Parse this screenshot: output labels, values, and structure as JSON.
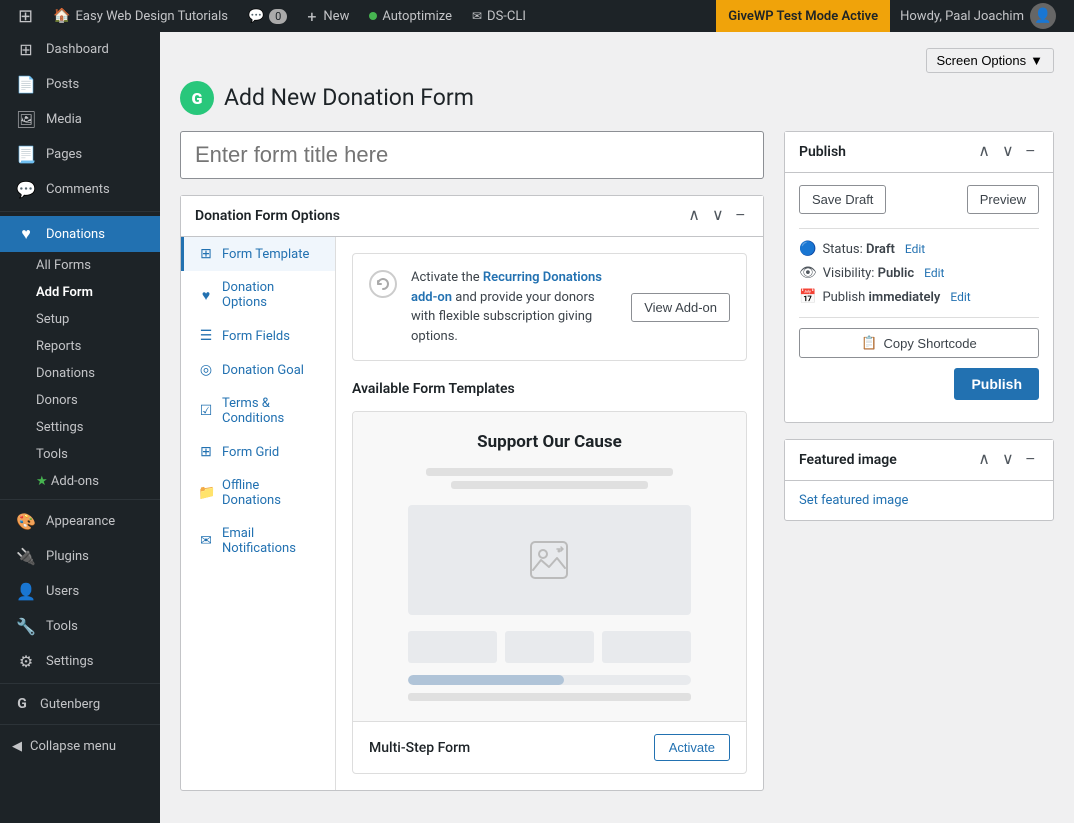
{
  "adminbar": {
    "site_name": "Easy Web Design Tutorials",
    "comments_count": "0",
    "new_label": "New",
    "autoptimize_label": "Autoptimize",
    "dscli_label": "DS-CLI",
    "test_mode_label": "GiveWP Test Mode Active",
    "howdy_label": "Howdy, Paal Joachim",
    "screen_options_label": "Screen Options"
  },
  "sidebar": {
    "items": [
      {
        "id": "dashboard",
        "label": "Dashboard",
        "icon": "⊞"
      },
      {
        "id": "posts",
        "label": "Posts",
        "icon": "📄"
      },
      {
        "id": "media",
        "label": "Media",
        "icon": "🖼"
      },
      {
        "id": "pages",
        "label": "Pages",
        "icon": "📃"
      },
      {
        "id": "comments",
        "label": "Comments",
        "icon": "💬"
      },
      {
        "id": "donations",
        "label": "Donations",
        "icon": "♥",
        "active": true
      },
      {
        "id": "appearance",
        "label": "Appearance",
        "icon": "🎨"
      },
      {
        "id": "plugins",
        "label": "Plugins",
        "icon": "🔌"
      },
      {
        "id": "users",
        "label": "Users",
        "icon": "👤"
      },
      {
        "id": "tools",
        "label": "Tools",
        "icon": "🔧"
      },
      {
        "id": "settings",
        "label": "Settings",
        "icon": "⚙"
      }
    ],
    "donations_submenu": [
      {
        "id": "all-forms",
        "label": "All Forms"
      },
      {
        "id": "add-form",
        "label": "Add Form",
        "active": true
      },
      {
        "id": "setup",
        "label": "Setup"
      },
      {
        "id": "reports",
        "label": "Reports"
      },
      {
        "id": "donations",
        "label": "Donations"
      },
      {
        "id": "donors",
        "label": "Donors"
      },
      {
        "id": "settings",
        "label": "Settings"
      },
      {
        "id": "tools",
        "label": "Tools"
      },
      {
        "id": "add-ons",
        "label": "Add-ons"
      }
    ],
    "other_items": [
      {
        "id": "gutenberg",
        "label": "Gutenberg",
        "icon": "G"
      }
    ],
    "collapse_label": "Collapse menu"
  },
  "page": {
    "title": "Add New Donation Form",
    "title_placeholder": "Enter form title here"
  },
  "donation_form_options": {
    "box_title": "Donation Form Options",
    "sidebar_items": [
      {
        "id": "form-template",
        "label": "Form Template",
        "icon": "⊞",
        "active": true
      },
      {
        "id": "donation-options",
        "label": "Donation Options",
        "icon": "♥"
      },
      {
        "id": "form-fields",
        "label": "Form Fields",
        "icon": "☰"
      },
      {
        "id": "donation-goal",
        "label": "Donation Goal",
        "icon": "◎"
      },
      {
        "id": "terms-conditions",
        "label": "Terms & Conditions",
        "icon": "☑"
      },
      {
        "id": "form-grid",
        "label": "Form Grid",
        "icon": "⊞"
      },
      {
        "id": "offline-donations",
        "label": "Offline Donations",
        "icon": "📁"
      },
      {
        "id": "email-notifications",
        "label": "Email Notifications",
        "icon": "✉"
      }
    ],
    "recurring_banner": {
      "text_before": "Activate the ",
      "addon_link": "Recurring Donations add-on",
      "text_after": " and provide your donors with flexible subscription giving options.",
      "button_label": "View Add-on"
    },
    "available_templates_title": "Available Form Templates",
    "template_card": {
      "preview_title": "Support Our Cause",
      "name": "Multi-Step Form",
      "activate_label": "Activate"
    }
  },
  "publish_box": {
    "title": "Publish",
    "save_draft_label": "Save Draft",
    "preview_label": "Preview",
    "status_label": "Status:",
    "status_value": "Draft",
    "status_edit": "Edit",
    "visibility_label": "Visibility:",
    "visibility_value": "Public",
    "visibility_edit": "Edit",
    "publish_label": "Publish",
    "publish_value": "immediately",
    "publish_edit": "Edit",
    "copy_shortcode_label": "Copy Shortcode",
    "publish_btn_label": "Publish"
  },
  "featured_image_box": {
    "title": "Featured image",
    "set_image_label": "Set featured image"
  }
}
